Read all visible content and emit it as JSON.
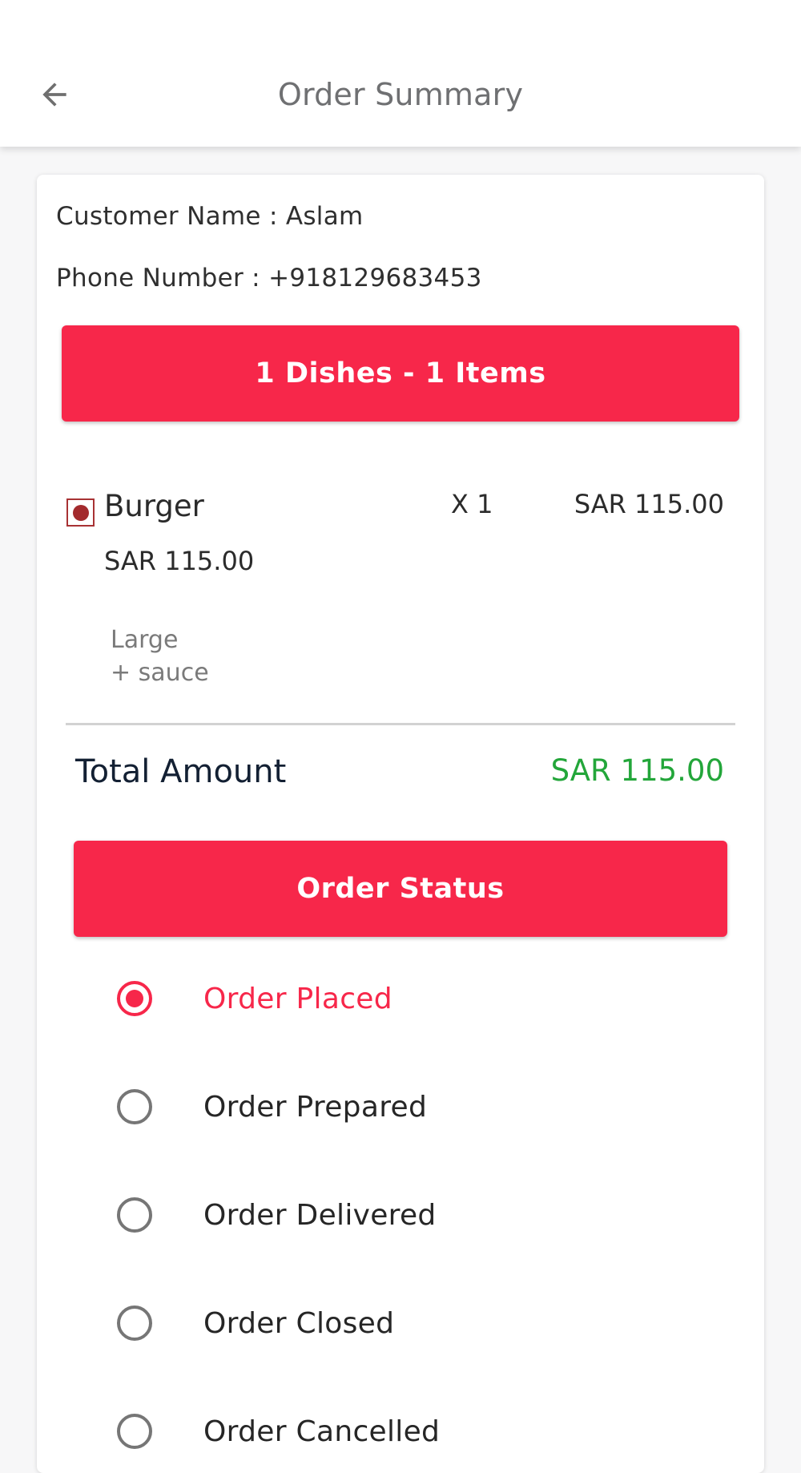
{
  "header": {
    "title": "Order Summary",
    "back_icon": "arrow-left-icon"
  },
  "customer": {
    "name_line": "Customer Name : Aslam",
    "phone_line": "Phone Number : +918129683453"
  },
  "summary_button": {
    "label": "1 Dishes - 1 Items"
  },
  "item": {
    "name": "Burger",
    "quantity": "X 1",
    "line_total": "SAR 115.00",
    "unit_price": "SAR 115.00",
    "variant_line1": "Large",
    "variant_line2": "+ sauce",
    "type_icon": "non-veg-mark-icon"
  },
  "total": {
    "label": "Total Amount",
    "value": "SAR 115.00"
  },
  "status_button": {
    "label": "Order Status"
  },
  "statuses": [
    {
      "label": "Order Placed",
      "selected": true
    },
    {
      "label": "Order Prepared",
      "selected": false
    },
    {
      "label": "Order Delivered",
      "selected": false
    },
    {
      "label": "Order Closed",
      "selected": false
    },
    {
      "label": "Order Cancelled",
      "selected": false
    }
  ],
  "colors": {
    "accent": "#f7274a",
    "total_green": "#23a63a",
    "non_veg_mark": "#a32a2d"
  }
}
